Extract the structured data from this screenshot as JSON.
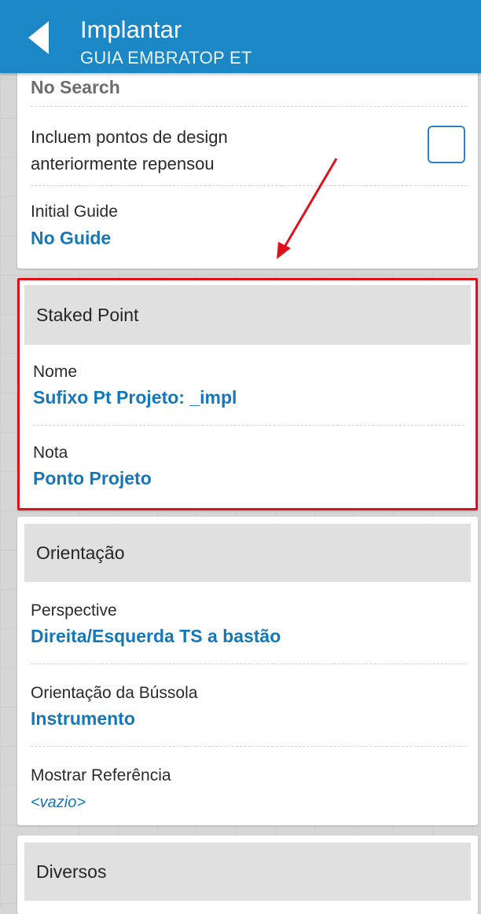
{
  "header": {
    "title": "Implantar",
    "subtitle": "GUIA EMBRATOP ET"
  },
  "top_card": {
    "partial_value": "No Search",
    "include_points_label_line1": "Incluem pontos de design",
    "include_points_label_line2": "anteriormente repensou",
    "include_points_checked": false,
    "initial_guide_label": "Initial Guide",
    "initial_guide_value": "No Guide"
  },
  "staked_point": {
    "section_title": "Staked Point",
    "name_label": "Nome",
    "name_value": "Sufixo Pt Projeto: _impl",
    "note_label": "Nota",
    "note_value": "Ponto Projeto"
  },
  "orientation": {
    "section_title": "Orientação",
    "perspective_label": "Perspective",
    "perspective_value": "Direita/Esquerda TS a bastão",
    "compass_label": "Orientação da Bússola",
    "compass_value": "Instrumento",
    "reference_label": "Mostrar Referência",
    "reference_value": "<vazio>"
  },
  "misc": {
    "section_title": "Diversos"
  },
  "colors": {
    "header_bg": "#1b87c5",
    "value_text": "#1477b8",
    "highlight_border": "#e0101a",
    "annotation_arrow": "#e0101a"
  }
}
